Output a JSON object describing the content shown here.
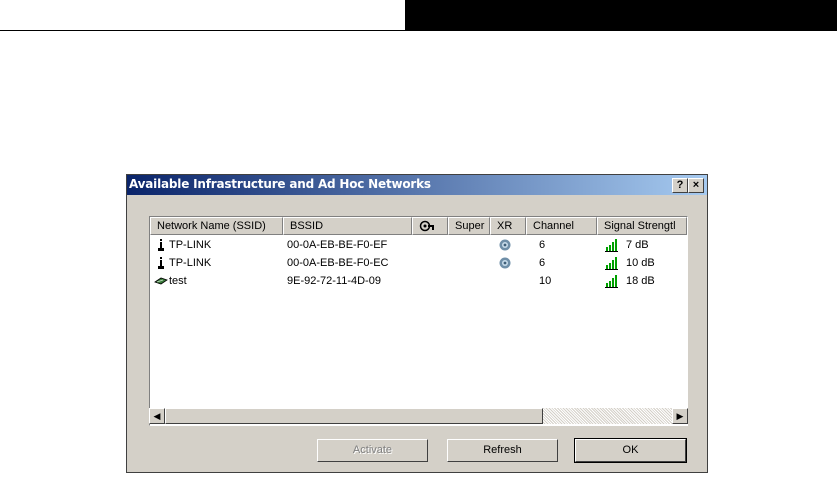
{
  "dialog": {
    "title": "Available Infrastructure and Ad Hoc Networks",
    "help_label": "?",
    "close_label": "×"
  },
  "columns": [
    "Network Name (SSID)",
    "BSSID",
    "",
    "Super",
    "XR",
    "Channel",
    "Signal Strengtl"
  ],
  "networks": [
    {
      "ssid": "TP-LINK",
      "bssid": "00-0A-EB-BE-F0-EF",
      "xr": true,
      "channel": "6",
      "signal": "7 dB",
      "type": "infrastructure"
    },
    {
      "ssid": "TP-LINK",
      "bssid": "00-0A-EB-BE-F0-EC",
      "xr": true,
      "channel": "6",
      "signal": "10 dB",
      "type": "infrastructure"
    },
    {
      "ssid": "test",
      "bssid": "9E-92-72-11-4D-09",
      "xr": false,
      "channel": "10",
      "signal": "18 dB",
      "type": "adhoc"
    }
  ],
  "buttons": {
    "activate": "Activate",
    "refresh": "Refresh",
    "ok": "OK"
  },
  "colors": {
    "title_start": "#0a246a",
    "title_end": "#a6caf0",
    "signal_green": "#00a000",
    "dialog_face": "#d4d0c8"
  },
  "icons": {
    "infrastructure": "access-point-icon",
    "adhoc": "adhoc-icon",
    "xr": "xr-icon",
    "signal": "signal-bars-icon",
    "security_header": "security-icon"
  }
}
